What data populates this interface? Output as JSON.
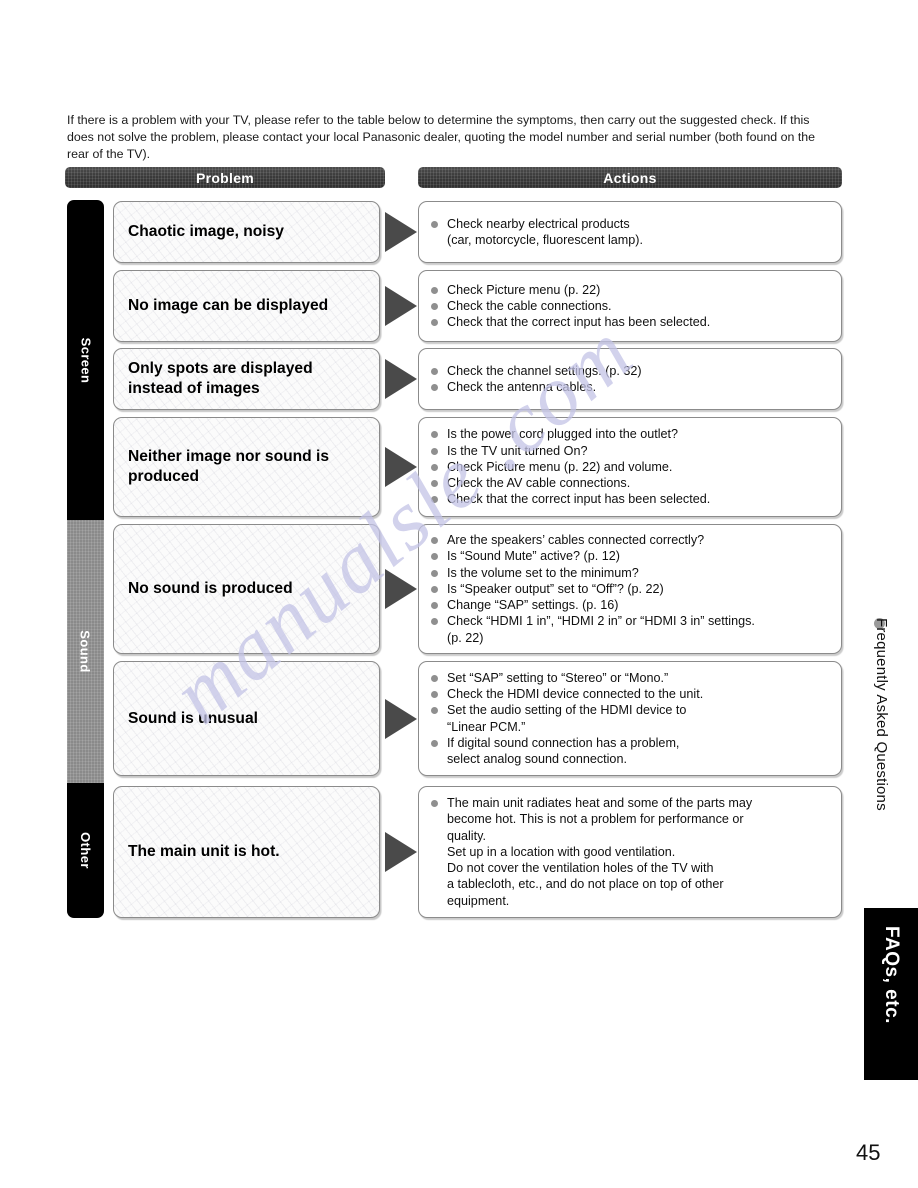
{
  "intro": "If there is a problem with your TV, please refer to the table below to determine the symptoms, then carry out the suggested check. If this does not solve the problem, please contact your local Panasonic dealer, quoting the model number and serial number (both found on the rear of the TV).",
  "headers": {
    "problem": "Problem",
    "actions": "Actions"
  },
  "categories": [
    {
      "label": "Screen",
      "color": "#000000"
    },
    {
      "label": "Sound",
      "color": "#8a8a8a"
    },
    {
      "label": "Other",
      "color": "#000000"
    }
  ],
  "rows": [
    {
      "category": "Screen",
      "problem": "Chaotic image, noisy",
      "actions": [
        "Check nearby electrical products\n(car, motorcycle, fluorescent lamp)."
      ]
    },
    {
      "category": "Screen",
      "problem": "No image can be displayed",
      "actions": [
        "Check Picture menu (p. 22)",
        "Check the cable connections.",
        "Check that the correct input has been selected."
      ]
    },
    {
      "category": "Screen",
      "problem": "Only spots are displayed instead of images",
      "actions": [
        "Check the channel settings. (p. 32)",
        "Check the antenna cables."
      ]
    },
    {
      "category": "Screen",
      "problem": "Neither image nor sound is produced",
      "actions": [
        "Is the power cord plugged into the outlet?",
        "Is the TV unit turned On?",
        "Check Picture menu (p. 22) and volume.",
        "Check the AV cable connections.",
        "Check that the correct input has been selected."
      ]
    },
    {
      "category": "Sound",
      "problem": "No sound is produced",
      "actions": [
        "Are the speakers’ cables connected correctly?",
        "Is “Sound Mute” active? (p. 12)",
        "Is the volume set to the minimum?",
        "Is “Speaker output” set to “Off”? (p. 22)",
        "Change “SAP” settings. (p. 16)",
        "Check “HDMI 1 in”, “HDMI 2 in” or “HDMI 3 in” settings.\n(p. 22)"
      ]
    },
    {
      "category": "Sound",
      "problem": "Sound is unusual",
      "actions": [
        "Set “SAP” setting to “Stereo” or “Mono.”",
        "Check the HDMI device connected to the unit.",
        "Set the audio setting of the HDMI device to\n“Linear PCM.”",
        "If digital sound connection has a problem,\nselect analog sound connection."
      ]
    },
    {
      "category": "Other",
      "problem": "The main unit is hot.",
      "actions": [
        "The main unit radiates heat and some of the parts may\nbecome hot. This is not a problem for performance or\nquality.\nSet up in a location with good ventilation.\nDo not cover the ventilation holes of the TV with\na tablecloth, etc., and do not place on top of other\nequipment."
      ]
    }
  ],
  "side_label": "Frequently Asked Questions",
  "tab_label": "FAQs, etc.",
  "page_number": "45",
  "watermark": "manualsle  .com"
}
